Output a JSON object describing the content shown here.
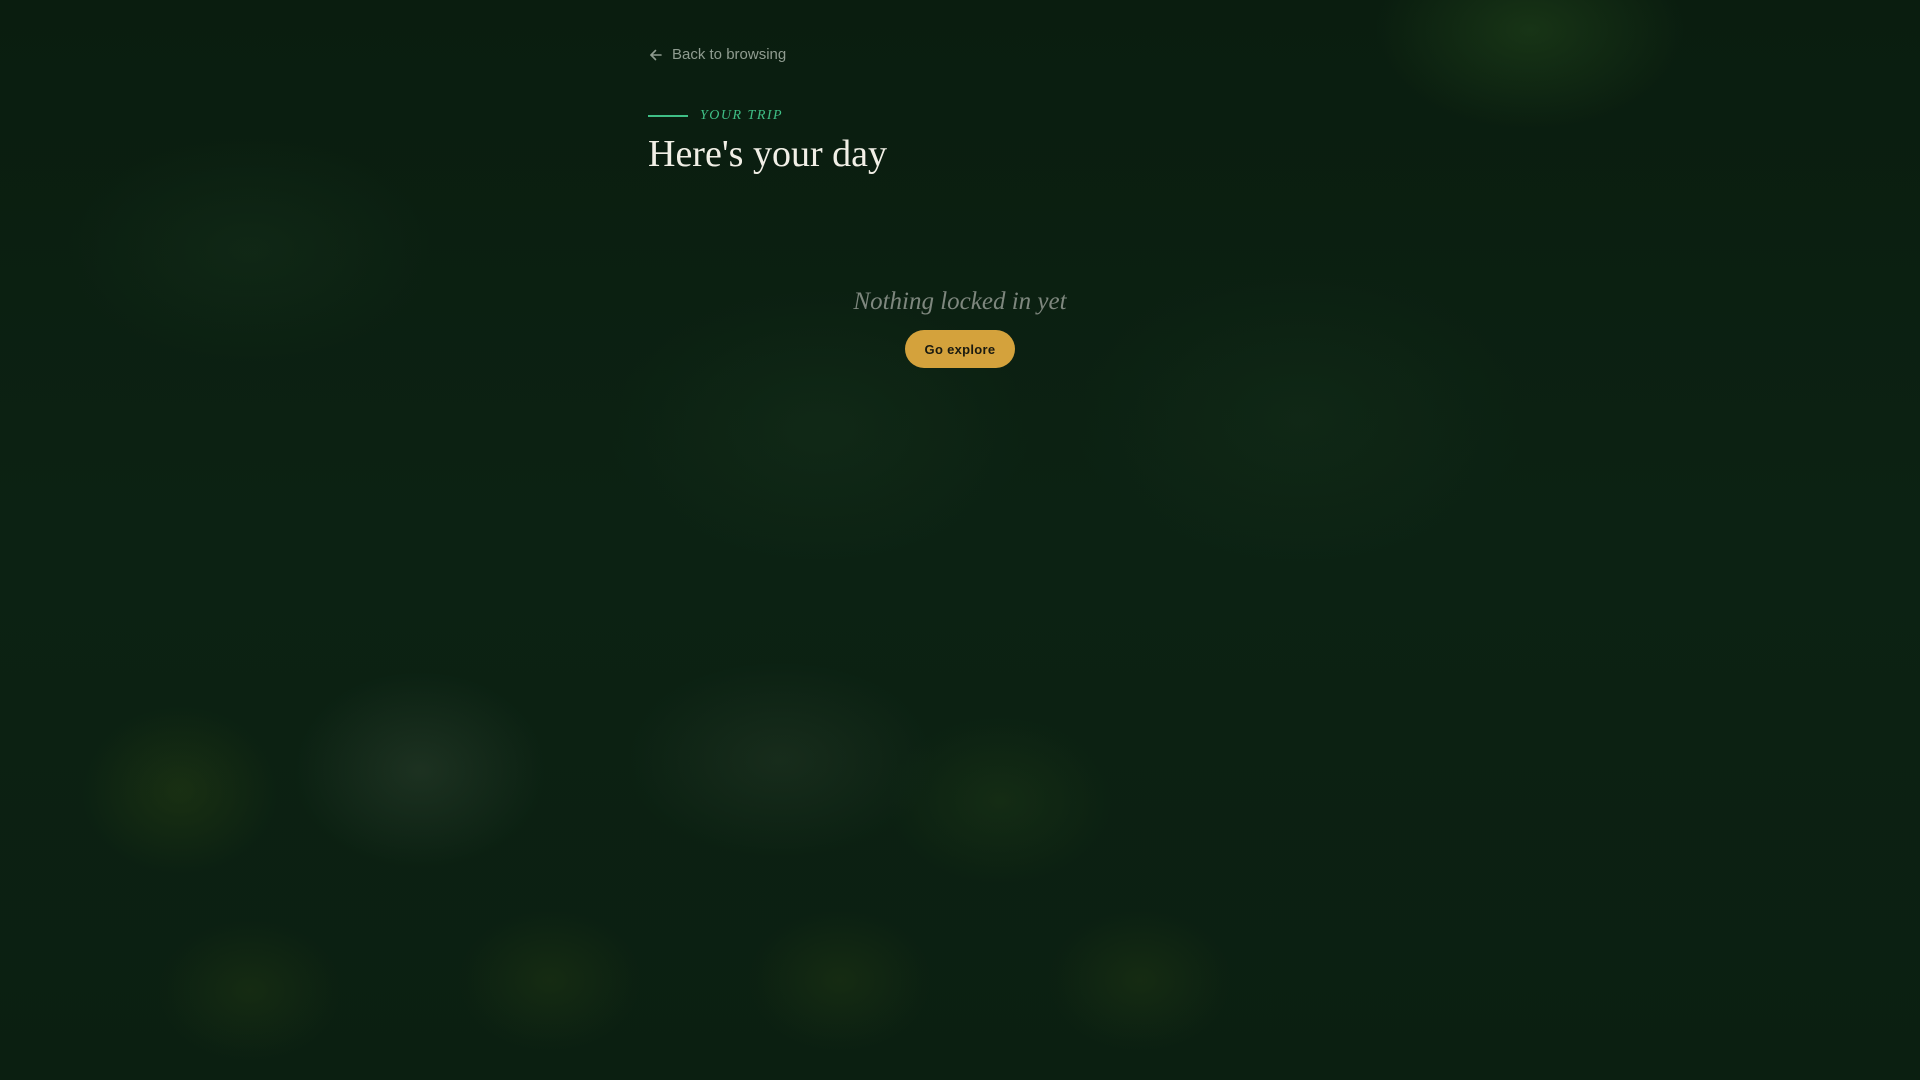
{
  "nav": {
    "back_label": "Back to browsing",
    "back_icon": "arrow-left-icon"
  },
  "header": {
    "eyebrow": "YOUR TRIP",
    "title": "Here's your day"
  },
  "empty_state": {
    "message": "Nothing locked in yet",
    "cta_label": "Go explore"
  },
  "colors": {
    "background": "#0b1e10",
    "accent_green": "#3fbf86",
    "cta_gold": "#d4a23c",
    "title_text": "#f1efe6",
    "muted_text": "#7e877e"
  }
}
